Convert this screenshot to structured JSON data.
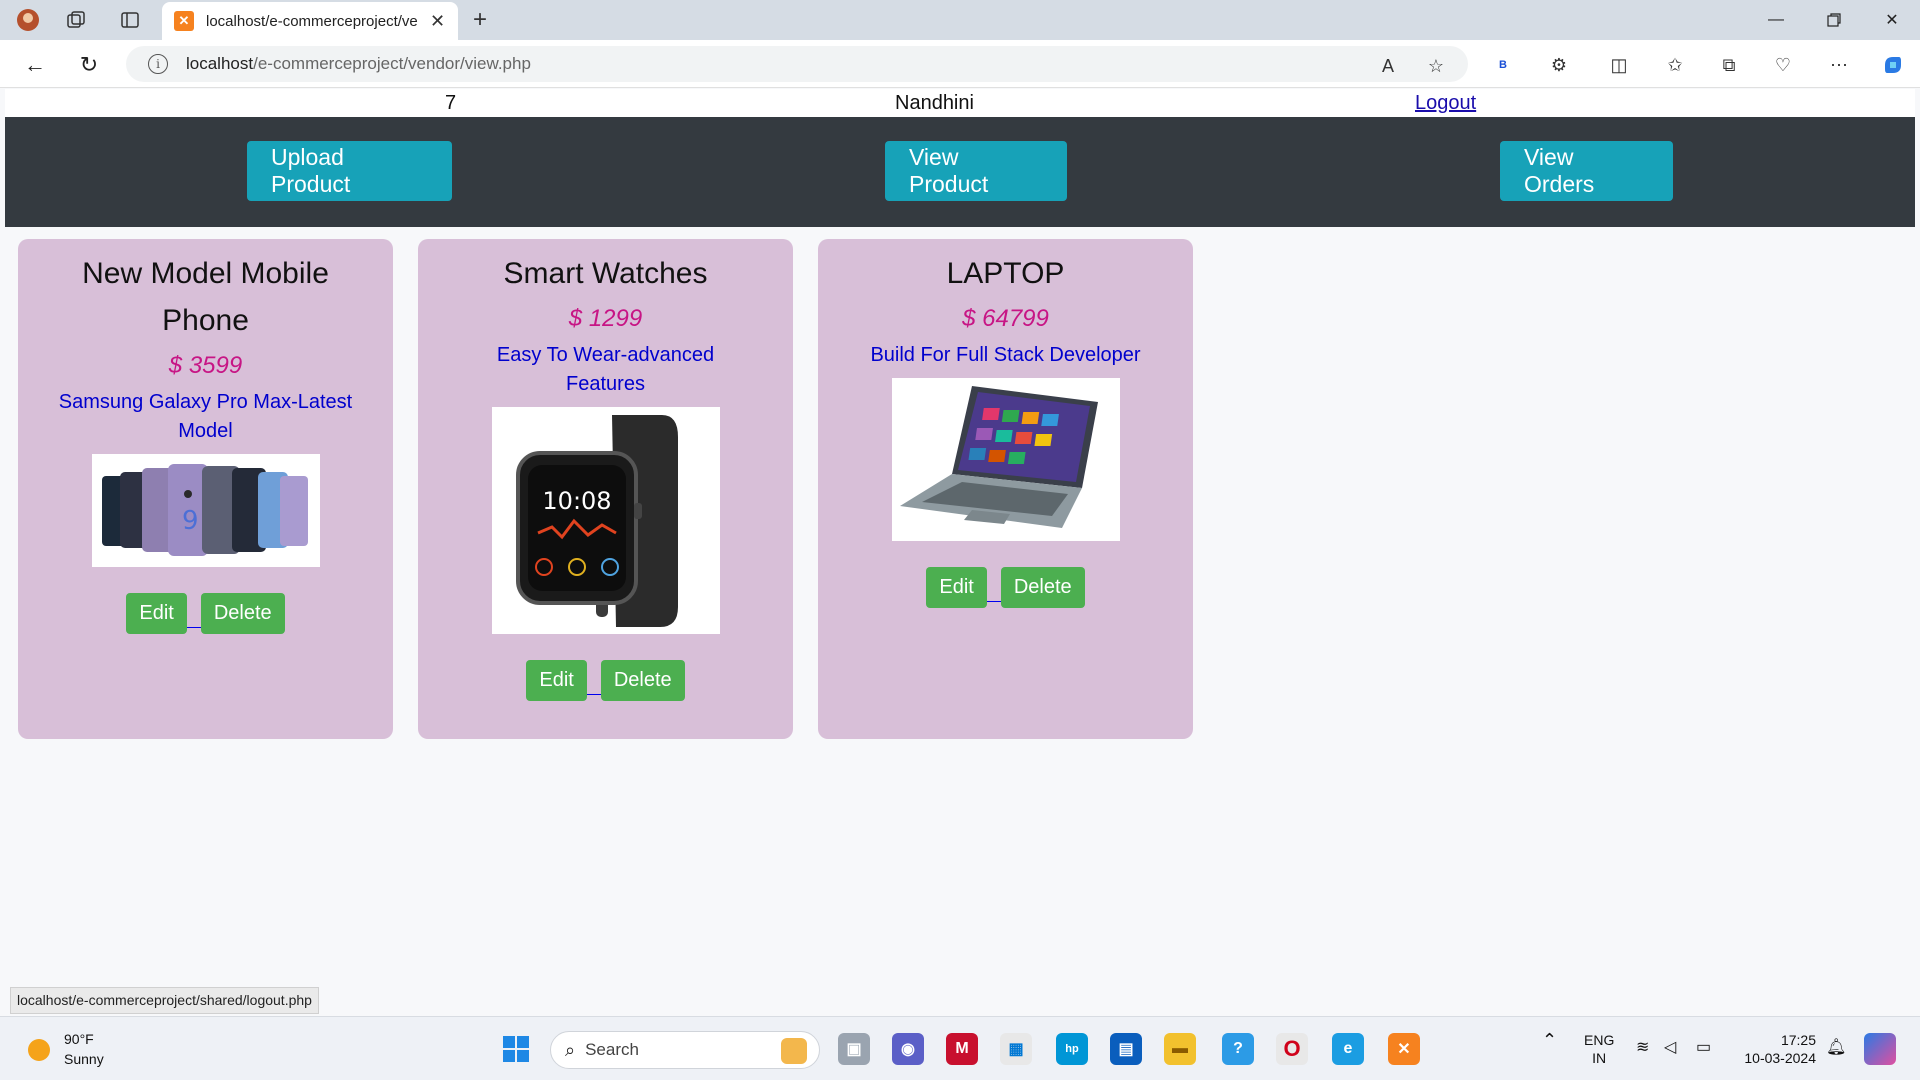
{
  "browser": {
    "tab_title": "localhost/e-commerceproject/ve",
    "url_host": "localhost",
    "url_path": "/e-commerceproject/vendor/view.php",
    "status_url": "localhost/e-commerceproject/shared/logout.php",
    "read_aloud_label": "A",
    "extension_badge": "B"
  },
  "header": {
    "user_id": "7",
    "user_name": "Nandhini",
    "logout_label": "Logout"
  },
  "menu": {
    "upload_label": "Upload Product",
    "view_product_label": "View Product",
    "view_orders_label": "View Orders"
  },
  "products": [
    {
      "name": "New Model Mobile Phone",
      "price": "$ 3599",
      "description": "Samsung Galaxy Pro Max-Latest Model",
      "edit_label": "Edit",
      "delete_label": "Delete"
    },
    {
      "name": "Smart Watches",
      "price": "$ 1299",
      "description": "Easy To Wear-advanced Features",
      "edit_label": "Edit",
      "delete_label": "Delete",
      "watch_time": "10:08"
    },
    {
      "name": "LAPTOP",
      "price": "$ 64799",
      "description": "Build For Full Stack Developer",
      "edit_label": "Edit",
      "delete_label": "Delete"
    }
  ],
  "taskbar": {
    "temperature": "90°F",
    "condition": "Sunny",
    "search_label": "Search",
    "language": "ENG",
    "region": "IN",
    "time": "17:25",
    "date": "10-03-2024"
  },
  "colors": {
    "menubar": "#343a40",
    "menu_button": "#17a2b8",
    "card": "#d8bfd8",
    "price": "#c71585",
    "description": "#0000cd",
    "action_button": "#4caf50"
  }
}
